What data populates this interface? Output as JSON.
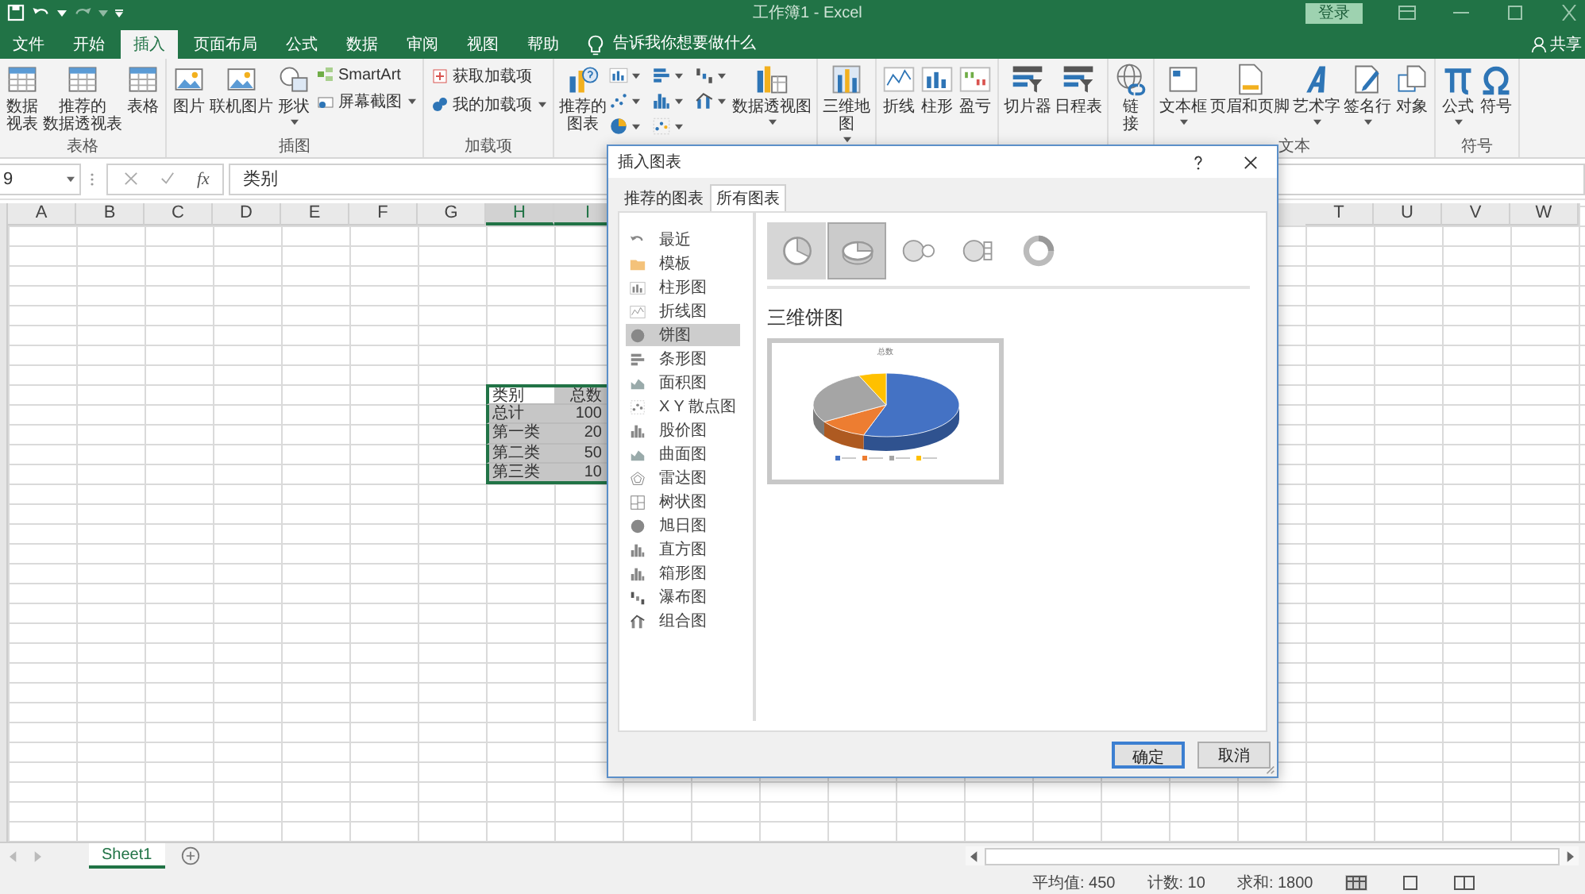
{
  "window": {
    "title": "工作簿1 - Excel",
    "sign_in": "登录"
  },
  "ribbon_tabs": [
    {
      "label": "文件",
      "selected": false
    },
    {
      "label": "开始",
      "selected": false
    },
    {
      "label": "插入",
      "selected": true
    },
    {
      "label": "页面布局",
      "selected": false
    },
    {
      "label": "公式",
      "selected": false
    },
    {
      "label": "数据",
      "selected": false
    },
    {
      "label": "审阅",
      "selected": false
    },
    {
      "label": "视图",
      "selected": false
    },
    {
      "label": "帮助",
      "selected": false
    }
  ],
  "tell_me": "告诉我你想要做什么",
  "share": "共享",
  "ribbon_groups": [
    {
      "label": "表格",
      "items": [
        {
          "kind": "big",
          "lines": [
            "数据",
            "视表"
          ],
          "dropdown": false
        },
        {
          "kind": "big",
          "lines": [
            "推荐的",
            "数据透视表"
          ],
          "dropdown": false
        },
        {
          "kind": "big",
          "lines": [
            "表格"
          ],
          "dropdown": false
        }
      ]
    },
    {
      "label": "插图",
      "items": [
        {
          "kind": "big",
          "lines": [
            "图片"
          ],
          "dropdown": false
        },
        {
          "kind": "big",
          "lines": [
            "联机图片"
          ],
          "dropdown": false
        },
        {
          "kind": "big",
          "lines": [
            "形状"
          ],
          "dropdown": true
        },
        {
          "kind": "stack",
          "entries": [
            {
              "label": "SmartArt",
              "dropdown": false
            },
            {
              "label": "屏幕截图",
              "dropdown": true
            }
          ]
        }
      ]
    },
    {
      "label": "加载项",
      "items": [
        {
          "kind": "stack",
          "entries": [
            {
              "label": "获取加载项",
              "dropdown": false
            },
            {
              "label": "我的加载项",
              "dropdown": true
            }
          ]
        }
      ]
    },
    {
      "items": [
        {
          "kind": "big",
          "lines": [
            "推荐的",
            "图表"
          ],
          "dropdown": false
        },
        {
          "kind": "icon_grid",
          "icons": [
            {
              "dropdown": true
            },
            {
              "dropdown": true
            },
            {
              "dropdown": true
            },
            {
              "dropdown": true
            },
            {
              "dropdown": true
            },
            {
              "dropdown": true
            },
            {
              "dropdown": true
            },
            {
              "dropdown": true
            }
          ]
        },
        {
          "kind": "big",
          "lines": [
            "数据透视图"
          ],
          "dropdown": true
        }
      ]
    },
    {
      "items": [
        {
          "kind": "big",
          "lines": [
            "三维地",
            "图"
          ],
          "dropdown": true
        }
      ]
    },
    {
      "items": [
        {
          "kind": "big",
          "lines": [
            "折线"
          ],
          "dropdown": false
        },
        {
          "kind": "big",
          "lines": [
            "柱形"
          ],
          "dropdown": false
        },
        {
          "kind": "big",
          "lines": [
            "盈亏"
          ],
          "dropdown": false
        }
      ]
    },
    {
      "items": [
        {
          "kind": "big",
          "lines": [
            "切片器"
          ],
          "dropdown": false
        },
        {
          "kind": "big",
          "lines": [
            "日程表"
          ],
          "dropdown": false
        }
      ]
    },
    {
      "items": [
        {
          "kind": "big",
          "lines": [
            "链",
            "接"
          ],
          "dropdown": false
        }
      ]
    },
    {
      "label": "文本",
      "items": [
        {
          "kind": "big",
          "lines": [
            "文本框"
          ],
          "dropdown": true
        },
        {
          "kind": "big",
          "lines": [
            "页眉和页脚"
          ],
          "dropdown": false
        },
        {
          "kind": "big",
          "lines": [
            "艺术字"
          ],
          "dropdown": true
        },
        {
          "kind": "big",
          "lines": [
            "签名行"
          ],
          "dropdown": true
        },
        {
          "kind": "big",
          "lines": [
            "对象"
          ],
          "dropdown": false
        }
      ]
    },
    {
      "label": "符号",
      "items": [
        {
          "kind": "big",
          "lines": [
            "公式"
          ],
          "dropdown": true
        },
        {
          "kind": "big",
          "lines": [
            "符号"
          ],
          "dropdown": false
        }
      ]
    }
  ],
  "formula_bar": {
    "name_box": "9",
    "function_label": "fx",
    "value": "类别"
  },
  "columns_left": [
    {
      "label": "A",
      "selected": false
    },
    {
      "label": "B",
      "selected": false
    },
    {
      "label": "C",
      "selected": false
    },
    {
      "label": "D",
      "selected": false
    },
    {
      "label": "E",
      "selected": false
    },
    {
      "label": "F",
      "selected": false
    },
    {
      "label": "G",
      "selected": false
    },
    {
      "label": "H",
      "selected": true
    },
    {
      "label": "I",
      "selected": true
    }
  ],
  "columns_right": [
    {
      "label": "T",
      "selected": false
    },
    {
      "label": "U",
      "selected": false
    },
    {
      "label": "V",
      "selected": false
    },
    {
      "label": "W",
      "selected": false
    }
  ],
  "table": {
    "rows": [
      [
        {
          "text": "类别",
          "selected": false
        },
        {
          "text": "总数",
          "selected": true
        }
      ],
      [
        {
          "text": "总计",
          "selected": true
        },
        {
          "text": "100",
          "selected": true
        }
      ],
      [
        {
          "text": "第一类",
          "selected": true
        },
        {
          "text": "20",
          "selected": true
        }
      ],
      [
        {
          "text": "第二类",
          "selected": true
        },
        {
          "text": "50",
          "selected": true
        }
      ],
      [
        {
          "text": "第三类",
          "selected": true
        },
        {
          "text": "10",
          "selected": true
        }
      ]
    ]
  },
  "sheets": [
    {
      "label": "Sheet1",
      "selected": true
    }
  ],
  "status_bar": {
    "stats": [
      "平均值: 450",
      "计数: 10",
      "求和: 1800"
    ]
  },
  "dialog": {
    "title": "插入图表",
    "tabs": [
      {
        "label": "推荐的图表",
        "selected": false
      },
      {
        "label": "所有图表",
        "selected": true
      }
    ],
    "chart_types": [
      {
        "label": "最近",
        "selected": false
      },
      {
        "label": "模板",
        "selected": false
      },
      {
        "label": "柱形图",
        "selected": false
      },
      {
        "label": "折线图",
        "selected": false
      },
      {
        "label": "饼图",
        "selected": true
      },
      {
        "label": "条形图",
        "selected": false
      },
      {
        "label": "面积图",
        "selected": false
      },
      {
        "label": "X Y 散点图",
        "selected": false
      },
      {
        "label": "股价图",
        "selected": false
      },
      {
        "label": "曲面图",
        "selected": false
      },
      {
        "label": "雷达图",
        "selected": false
      },
      {
        "label": "树状图",
        "selected": false
      },
      {
        "label": "旭日图",
        "selected": false
      },
      {
        "label": "直方图",
        "selected": false
      },
      {
        "label": "箱形图",
        "selected": false
      },
      {
        "label": "瀑布图",
        "selected": false
      },
      {
        "label": "组合图",
        "selected": false
      }
    ],
    "subtypes": [
      {
        "selected": false,
        "hovered": true
      },
      {
        "selected": true,
        "hovered": false
      },
      {
        "selected": false,
        "hovered": false
      },
      {
        "selected": false,
        "hovered": false
      },
      {
        "selected": false,
        "hovered": false
      }
    ],
    "subtype_title": "三维饼图",
    "preview": {
      "title": "总数",
      "legend": [
        {
          "color": "#4472c4"
        },
        {
          "color": "#ed7d31"
        },
        {
          "color": "#a5a5a5"
        },
        {
          "color": "#ffc000"
        }
      ]
    },
    "buttons": [
      {
        "label": "确定",
        "default": true
      },
      {
        "label": "取消",
        "default": false
      }
    ]
  }
}
